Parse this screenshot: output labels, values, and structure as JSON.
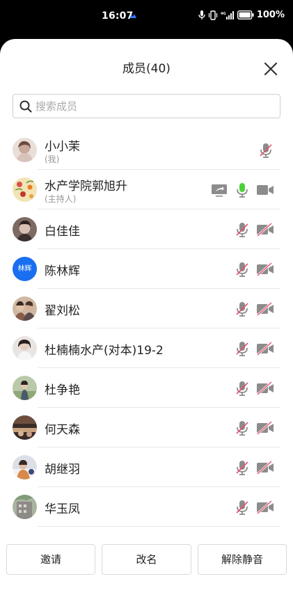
{
  "status_bar": {
    "time": "16:07",
    "battery_text": "100%"
  },
  "header": {
    "title": "成员(40)"
  },
  "search": {
    "placeholder": "搜索成员"
  },
  "members": [
    {
      "name": "小小茉",
      "role": "(我)",
      "avatar": "photo-girl",
      "mic": "muted"
    },
    {
      "name": "水产学院郭旭升",
      "role": "(主持人)",
      "avatar": "photo-floral",
      "mic": "active",
      "camera": "off-plain",
      "screen_share": true
    },
    {
      "name": "白佳佳",
      "avatar": "photo-portrait",
      "mic": "muted",
      "camera": "off"
    },
    {
      "name": "陈林辉",
      "avatar_text": "林辉",
      "avatar_color": "#1a6ef0",
      "mic": "muted",
      "camera": "off"
    },
    {
      "name": "翟刘松",
      "avatar": "photo-couple",
      "mic": "muted",
      "camera": "off"
    },
    {
      "name": "杜楠楠水产(对本)19-2",
      "avatar": "photo-girl-white",
      "mic": "muted",
      "camera": "off"
    },
    {
      "name": "杜争艳",
      "avatar": "photo-outdoor",
      "mic": "muted",
      "camera": "off"
    },
    {
      "name": "何天森",
      "avatar": "photo-dark",
      "mic": "muted",
      "camera": "off"
    },
    {
      "name": "胡继羽",
      "avatar": "photo-snow",
      "mic": "muted",
      "camera": "off"
    },
    {
      "name": "华玉凤",
      "avatar": "photo-building",
      "mic": "muted",
      "camera": "off"
    }
  ],
  "buttons": {
    "invite": "邀请",
    "rename": "改名",
    "unmute_all": "解除静音"
  },
  "colors": {
    "accent": "#1a6ef0",
    "mic_active": "#4cd038",
    "muted_slash": "#e8506b",
    "icon_gray": "#8c8c8c"
  }
}
